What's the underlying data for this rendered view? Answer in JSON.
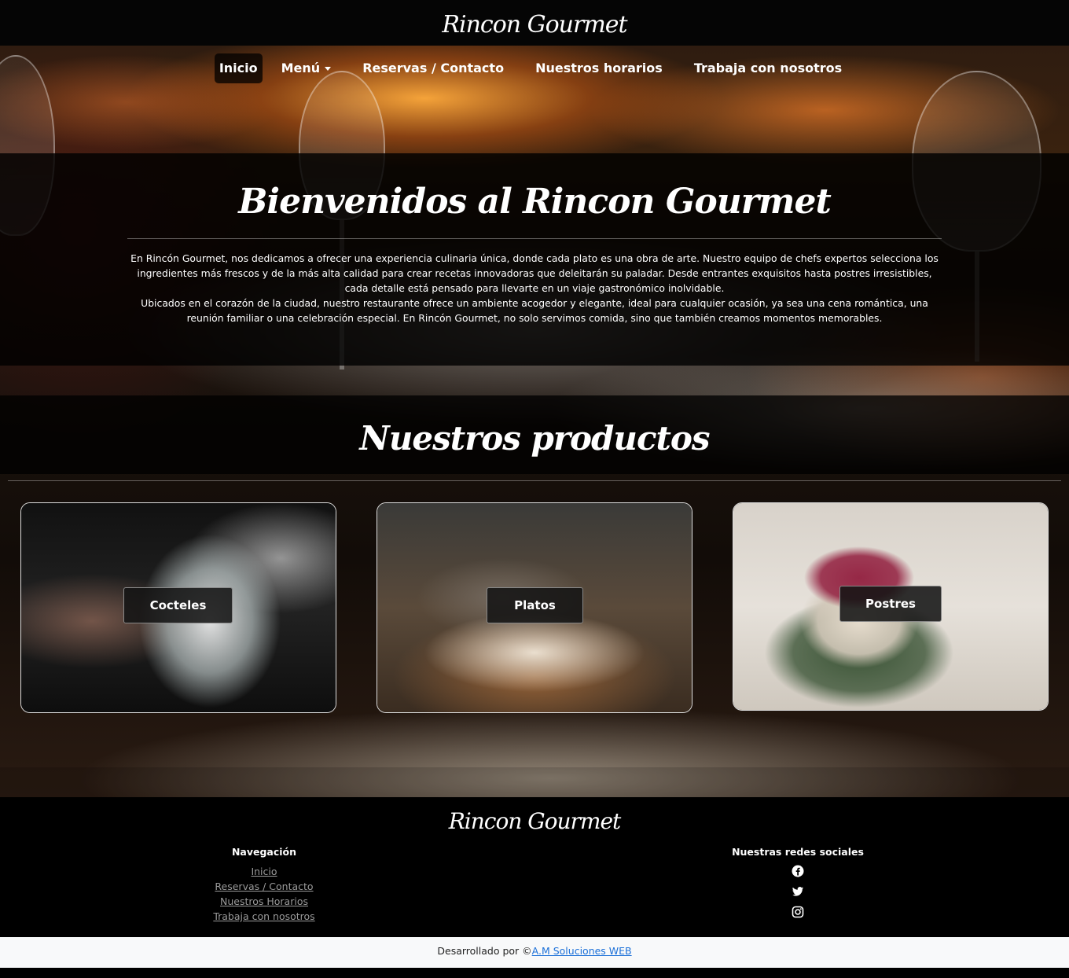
{
  "brand": "Rincon Gourmet",
  "nav": {
    "items": [
      {
        "label": "Inicio",
        "active": true
      },
      {
        "label": "Menú",
        "dropdown": true
      },
      {
        "label": "Reservas / Contacto"
      },
      {
        "label": "Nuestros horarios"
      },
      {
        "label": "Trabaja con nosotros"
      }
    ]
  },
  "welcome": {
    "title": "Bienvenidos al Rincon Gourmet",
    "paragraph1": "En Rincón Gourmet, nos dedicamos a ofrecer una experiencia culinaria única, donde cada plato es una obra de arte. Nuestro equipo de chefs expertos selecciona los ingredientes más frescos y de la más alta calidad para crear recetas innovadoras que deleitarán su paladar. Desde entrantes exquisitos hasta postres irresistibles, cada detalle está pensado para llevarte en un viaje gastronómico inolvidable.",
    "paragraph2": "Ubicados en el corazón de la ciudad, nuestro restaurante ofrece un ambiente acogedor y elegante, ideal para cualquier ocasión, ya sea una cena romántica, una reunión familiar o una celebración especial. En Rincón Gourmet, no solo servimos comida, sino que también creamos momentos memorables."
  },
  "products": {
    "title": "Nuestros productos",
    "cards": [
      {
        "label": "Cocteles"
      },
      {
        "label": "Platos"
      },
      {
        "label": "Postres"
      }
    ]
  },
  "footer": {
    "brand": "Rincon Gourmet",
    "nav_heading": "Navegación",
    "links": [
      "Inicio",
      "Reservas / Contacto",
      "Nuestros Horarios",
      "Trabaja con nosotros"
    ],
    "social_heading": "Nuestras redes sociales",
    "social_icons": [
      "facebook-icon",
      "twitter-icon",
      "instagram-icon"
    ]
  },
  "credit": {
    "prefix": "Desarrollado por ©",
    "link": "A.M Soluciones WEB"
  },
  "colors": {
    "link": "#1a6fd8",
    "footer_link": "#9a9a9a",
    "credit_bg": "#f8f9fa"
  }
}
